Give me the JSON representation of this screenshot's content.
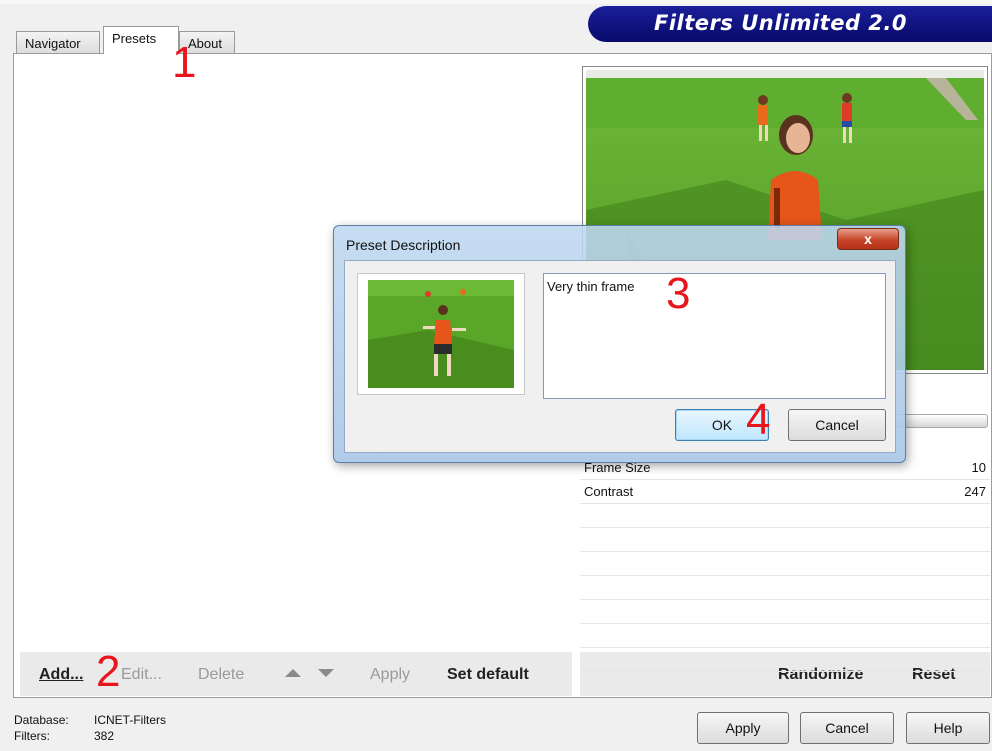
{
  "app": {
    "brand_title": "Filters Unlimited 2.0"
  },
  "tabs": [
    {
      "label": "Navigator",
      "active": false
    },
    {
      "label": "Presets",
      "active": true
    },
    {
      "label": "About",
      "active": false
    }
  ],
  "preset_toolbar": {
    "add": "Add...",
    "edit": "Edit...",
    "delete": "Delete",
    "move_up_icon": "triangle-up",
    "move_down_icon": "triangle-down",
    "apply": "Apply",
    "set_default": "Set default"
  },
  "params_toolbar": {
    "randomize": "Randomize",
    "reset": "Reset"
  },
  "parameters": [
    {
      "name": "Frame Size",
      "value": "10"
    },
    {
      "name": "Contrast",
      "value": "247"
    }
  ],
  "status": {
    "database_label": "Database:",
    "database_value": "ICNET-Filters",
    "filters_label": "Filters:",
    "filters_value": "382"
  },
  "buttons": {
    "apply": "Apply",
    "cancel": "Cancel",
    "help": "Help"
  },
  "dialog": {
    "title": "Preset Description",
    "close_glyph": "x",
    "description": "Very thin frame",
    "ok": "OK",
    "cancel": "Cancel"
  },
  "steps": [
    "1",
    "2",
    "3",
    "4"
  ],
  "colors": {
    "brand_bg": "#0d0f7a",
    "step_red": "#e8161c",
    "close_red": "#c6452a"
  }
}
